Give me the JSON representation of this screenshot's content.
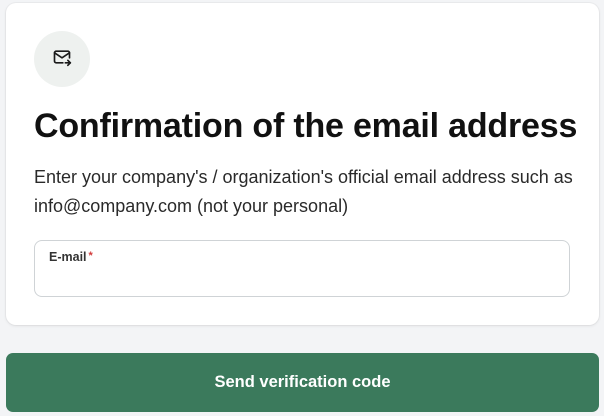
{
  "card": {
    "icon": "mail-forward-icon",
    "title": "Confirmation of the email address",
    "description": "Enter your company's / organization's official email address such as info@company.com (not your personal)",
    "email_field": {
      "label": "E-mail",
      "required_mark": "*",
      "value": "",
      "placeholder": ""
    }
  },
  "submit_button": {
    "label": "Send verification code"
  },
  "colors": {
    "accent": "#3b7a5c",
    "required": "#d23b3b",
    "icon_bg": "#eef1ef"
  }
}
